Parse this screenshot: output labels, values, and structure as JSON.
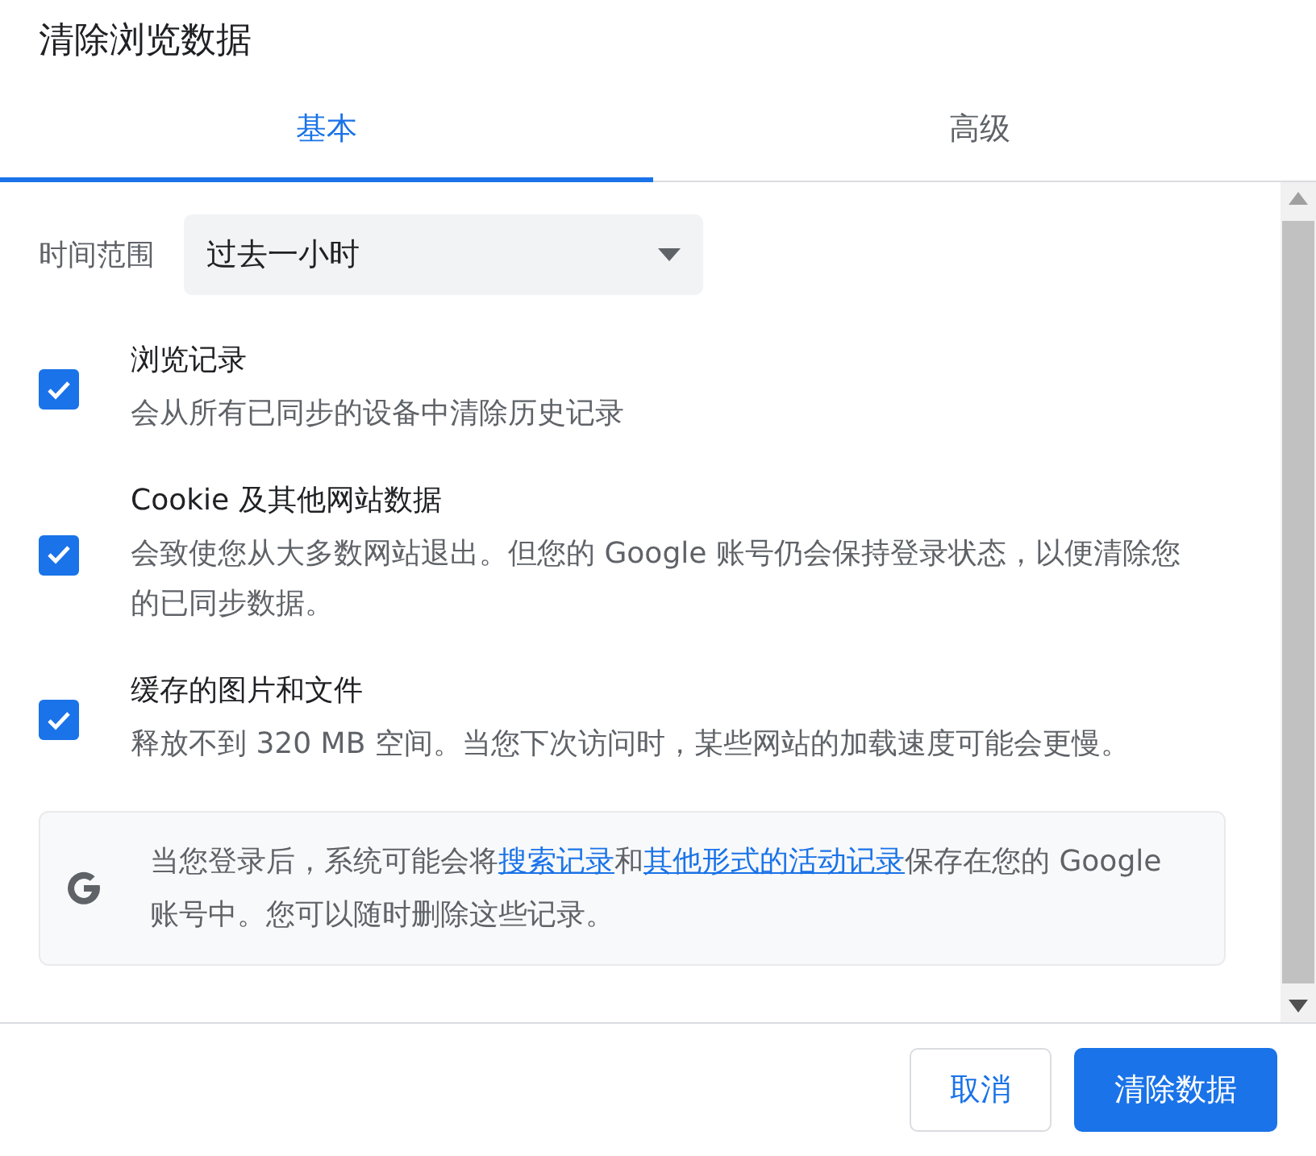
{
  "window": {
    "title": "清除浏览数据"
  },
  "tabs": [
    {
      "label": "基本",
      "selected": true
    },
    {
      "label": "高级",
      "selected": false
    }
  ],
  "time_range": {
    "label": "时间范围",
    "value": "过去一小时"
  },
  "options": [
    {
      "title": "浏览记录",
      "description": "会从所有已同步的设备中清除历史记录",
      "checked": true
    },
    {
      "title": "Cookie 及其他网站数据",
      "description": "会致使您从大多数网站退出。但您的 Google 账号仍会保持登录状态，以便清除您的已同步数据。",
      "checked": true
    },
    {
      "title": "缓存的图片和文件",
      "description": "释放不到 320 MB 空间。当您下次访问时，某些网站的加载速度可能会更慢。",
      "checked": true
    }
  ],
  "info": {
    "segments": [
      {
        "kind": "text",
        "text": "当您登录后，系统可能会将"
      },
      {
        "kind": "link",
        "text": "搜索记录"
      },
      {
        "kind": "text",
        "text": "和"
      },
      {
        "kind": "link",
        "text": "其他形式的活动记录"
      },
      {
        "kind": "text",
        "text": "保存在您的 Google 账号中。您可以随时删除这些记录。"
      }
    ]
  },
  "buttons": [
    {
      "label": "取消",
      "kind": "secondary"
    },
    {
      "label": "清除数据",
      "kind": "primary"
    }
  ]
}
